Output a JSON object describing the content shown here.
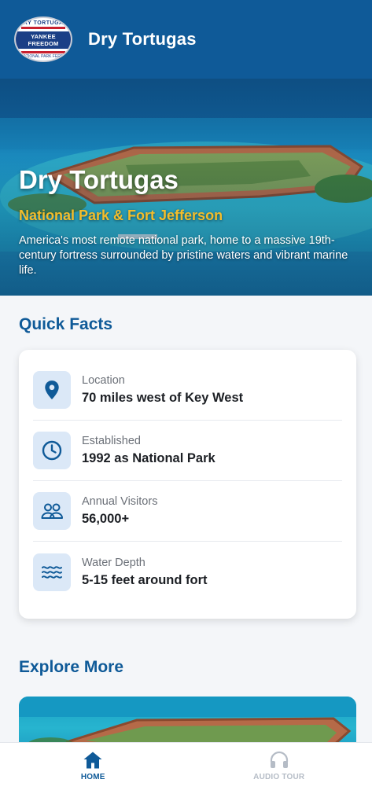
{
  "header": {
    "title": "Dry Tortugas",
    "logo": {
      "top_text": "DRY TORTUGAS",
      "band_text": "YANKEE FREEDOM",
      "bottom_text": "NATIONAL PARK FERRY"
    }
  },
  "hero": {
    "title": "Dry Tortugas",
    "subtitle": "National Park & Fort Jefferson",
    "description": "America's most remote national park, home to a massive 19th-century fortress surrounded by pristine waters and vibrant marine life."
  },
  "quick_facts": {
    "heading": "Quick Facts",
    "items": [
      {
        "icon": "location-pin-icon",
        "label": "Location",
        "value": "70 miles west of Key West"
      },
      {
        "icon": "clock-icon",
        "label": "Established",
        "value": "1992 as National Park"
      },
      {
        "icon": "people-icon",
        "label": "Annual Visitors",
        "value": "56,000+"
      },
      {
        "icon": "waves-icon",
        "label": "Water Depth",
        "value": "5-15 feet around fort"
      }
    ]
  },
  "explore": {
    "heading": "Explore More"
  },
  "bottom_nav": {
    "items": [
      {
        "icon": "home-icon",
        "label": "HOME",
        "active": true
      },
      {
        "icon": "headphones-icon",
        "label": "AUDIO TOUR",
        "active": false
      }
    ]
  },
  "colors": {
    "primary": "#0f5a98",
    "accent_gold": "#f3bd2b",
    "icon_bg": "#dbe8f7",
    "inactive_nav": "#b5bcc6"
  }
}
